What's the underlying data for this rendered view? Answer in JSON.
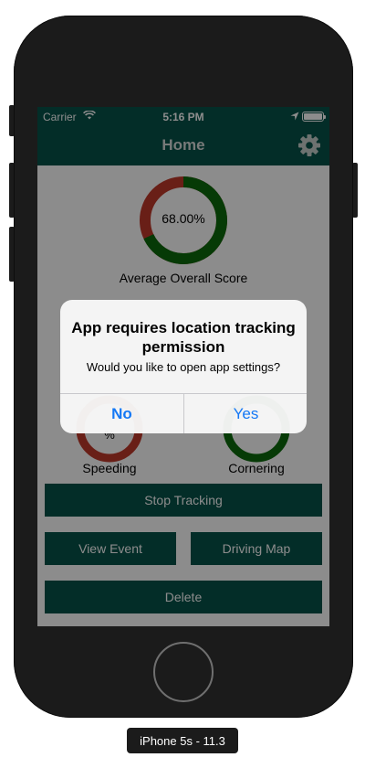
{
  "status_bar": {
    "carrier": "Carrier",
    "time": "5:16 PM"
  },
  "nav": {
    "title": "Home"
  },
  "scores": {
    "overall": {
      "value_text": "68.00%",
      "label": "Average Overall Score",
      "fraction": 0.68,
      "good_color": "#0b6b0b",
      "bad_color": "#c0392b"
    },
    "speeding": {
      "label": "Speeding",
      "value_text": "%"
    },
    "cornering": {
      "label": "Cornering"
    }
  },
  "buttons": {
    "stop_tracking": "Stop Tracking",
    "view_event": "View Event",
    "driving_map": "Driving Map",
    "delete": "Delete"
  },
  "alert": {
    "title": "App requires location tracking permission",
    "message": "Would you like to open app settings?",
    "no_label": "No",
    "yes_label": "Yes"
  },
  "device": {
    "caption": "iPhone 5s - 11.3"
  },
  "colors": {
    "accent": "#07524a",
    "alert_button": "#1478f5"
  },
  "icons": [
    "wifi-icon",
    "location-arrow-icon",
    "battery-icon",
    "gear-icon"
  ]
}
